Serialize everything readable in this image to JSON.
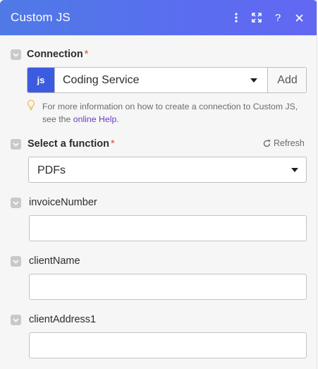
{
  "header": {
    "title": "Custom JS",
    "icons": [
      "more-vertical-icon",
      "expand-icon",
      "help-icon",
      "close-icon"
    ],
    "icon_glyphs": {
      "help": "?"
    },
    "gradient_colors": [
      "#4f7ae6",
      "#6367f2"
    ]
  },
  "connection": {
    "label": "Connection",
    "required_mark": "*",
    "badge": "js",
    "selected_value": "Coding Service",
    "add_label": "Add",
    "hint_text": "For more information on how to create a connection to Custom JS, see the",
    "hint_link": "online Help",
    "hint_end": "."
  },
  "function_select": {
    "label": "Select a function",
    "required_mark": "*",
    "refresh_label": "Refresh",
    "selected_value": "PDFs"
  },
  "fields": [
    {
      "label": "invoiceNumber",
      "value": ""
    },
    {
      "label": "clientName",
      "value": ""
    },
    {
      "label": "clientAddress1",
      "value": ""
    }
  ],
  "colors": {
    "accent_blue": "#3c5ce0",
    "required_red": "#e3473f",
    "link_purple": "#6b3bc9"
  }
}
